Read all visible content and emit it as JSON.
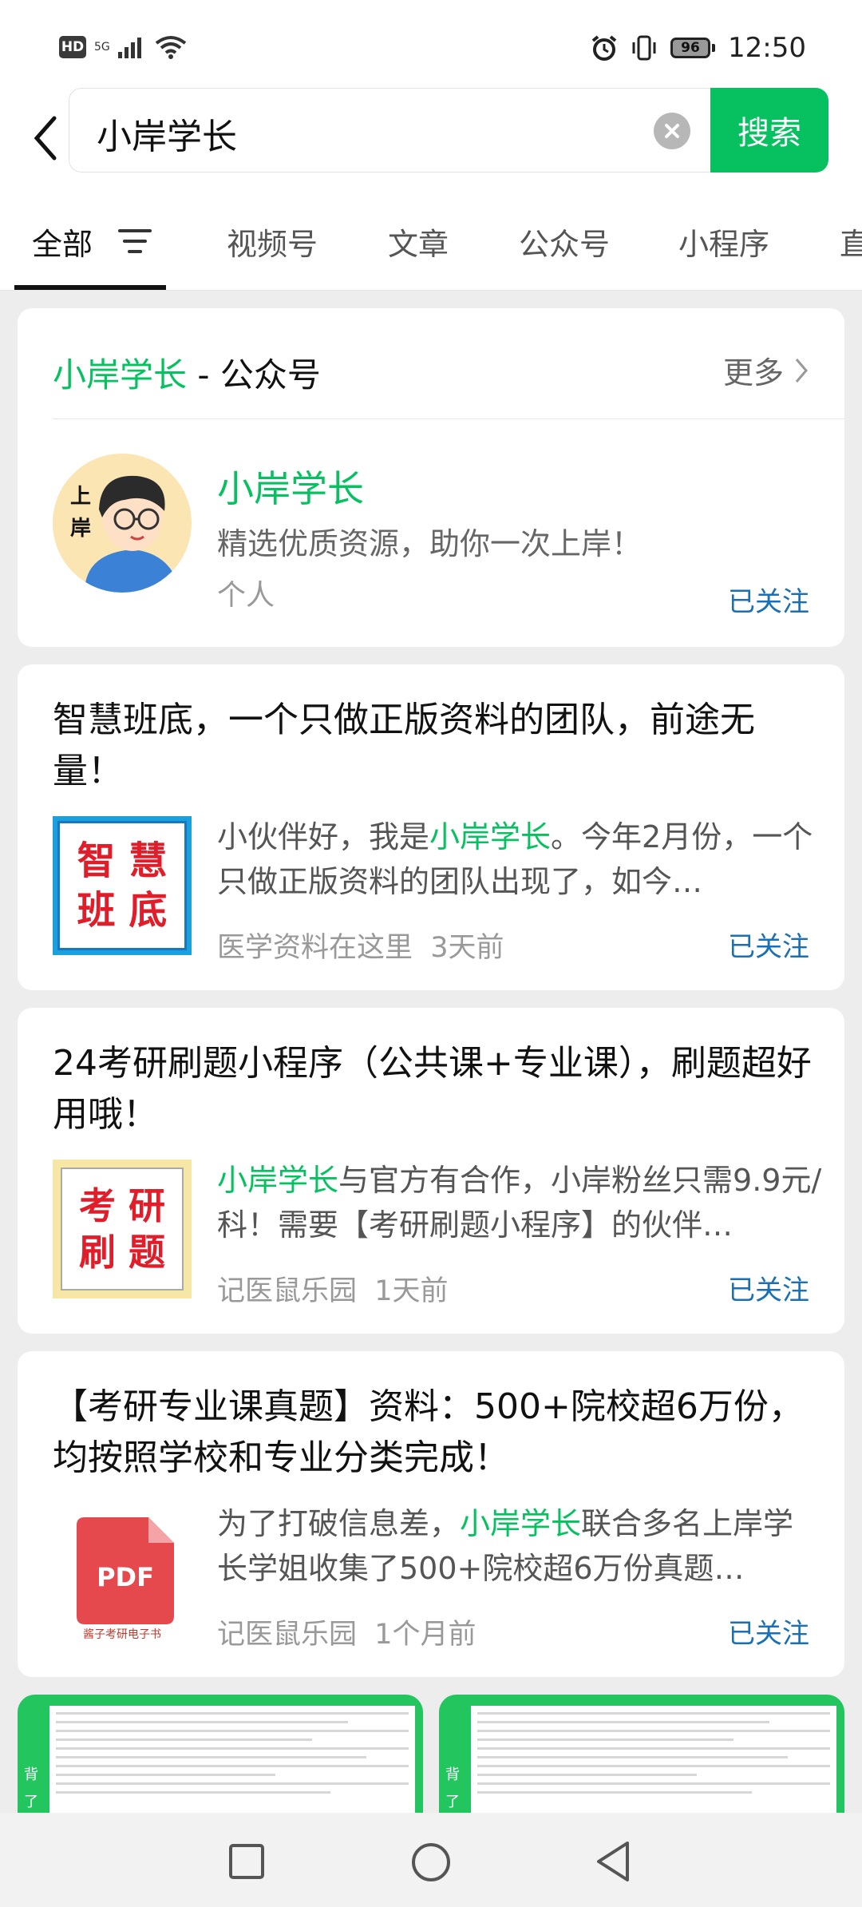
{
  "status_bar": {
    "hd": "HD",
    "network": "5G",
    "battery": "96",
    "time": "12:50"
  },
  "search": {
    "query": "小岸学长",
    "button": "搜索"
  },
  "tabs": [
    "全部",
    "视频号",
    "文章",
    "公众号",
    "小程序",
    "直"
  ],
  "account_card": {
    "title_highlight": "小岸学长",
    "title_suffix": " - 公众号",
    "more": "更多",
    "name": "小岸学长",
    "description": "精选优质资源，助你一次上岸！",
    "type": "个人",
    "follow": "已关注",
    "avatar_text": "上岸"
  },
  "articles": [
    {
      "title": "智慧班底，一个只做正版资料的团队，前途无量！",
      "snippet_pre": "小伙伴好，我是",
      "snippet_hl": "小岸学长",
      "snippet_post": "。今年2月份，一个只做正版资料的团队出现了，如今…",
      "source": "医学资料在这里",
      "time": "3天前",
      "follow": "已关注",
      "thumb_text_1": "智 慧",
      "thumb_text_2": "班 底"
    },
    {
      "title": "24考研刷题小程序（公共课+专业课），刷题超好用哦！",
      "snippet_pre": "",
      "snippet_hl": "小岸学长",
      "snippet_post": "与官方有合作，小岸粉丝只需9.9元/科！需要【考研刷题小程序】的伙伴…",
      "source": "记医鼠乐园",
      "time": "1天前",
      "follow": "已关注",
      "thumb_text_1": "考 研",
      "thumb_text_2": "刷 题"
    },
    {
      "title": "【考研专业课真题】资料：500+院校超6万份，均按照学校和专业分类完成！",
      "snippet_pre": "为了打破信息差，",
      "snippet_hl": "小岸学长",
      "snippet_post": "联合多名上岸学长学姐收集了500+院校超6万份真题…",
      "source": "记医鼠乐园",
      "time": "1个月前",
      "follow": "已关注",
      "thumb_pdf": "PDF",
      "thumb_caption": "酱子考研电子书"
    }
  ],
  "bottom_cards": [
    {
      "side_text": "背了"
    },
    {
      "side_text": "背了"
    }
  ]
}
